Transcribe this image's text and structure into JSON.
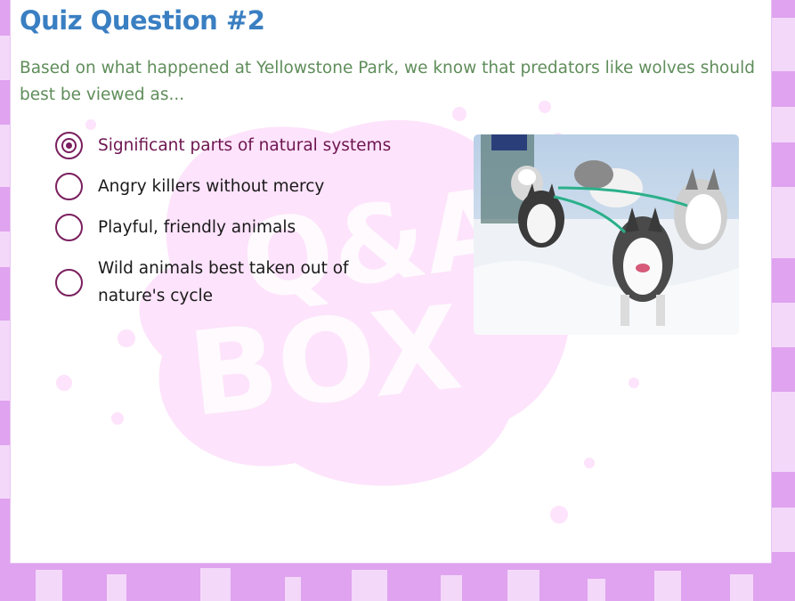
{
  "quiz": {
    "title": "Quiz Question #2",
    "question": "Based on what happened at Yellowstone Park, we know that predators like wolves should best be viewed as...",
    "options": [
      {
        "label": "Significant parts of natural systems",
        "selected": true
      },
      {
        "label": "Angry killers without mercy",
        "selected": false
      },
      {
        "label": "Playful, friendly animals",
        "selected": false
      },
      {
        "label_line1": "Wild animals best taken out of",
        "label_line2": "nature's cycle",
        "selected": false
      }
    ]
  },
  "watermark": {
    "line1": "Q&A",
    "line2": "BOX"
  },
  "colors": {
    "title": "#3a7fc2",
    "question": "#5f8d5a",
    "radio": "#7a1f5e",
    "background": "#dfa3ef",
    "watermark": "#fde3fb"
  },
  "icons": {
    "photo": "sled-dogs-photo"
  }
}
